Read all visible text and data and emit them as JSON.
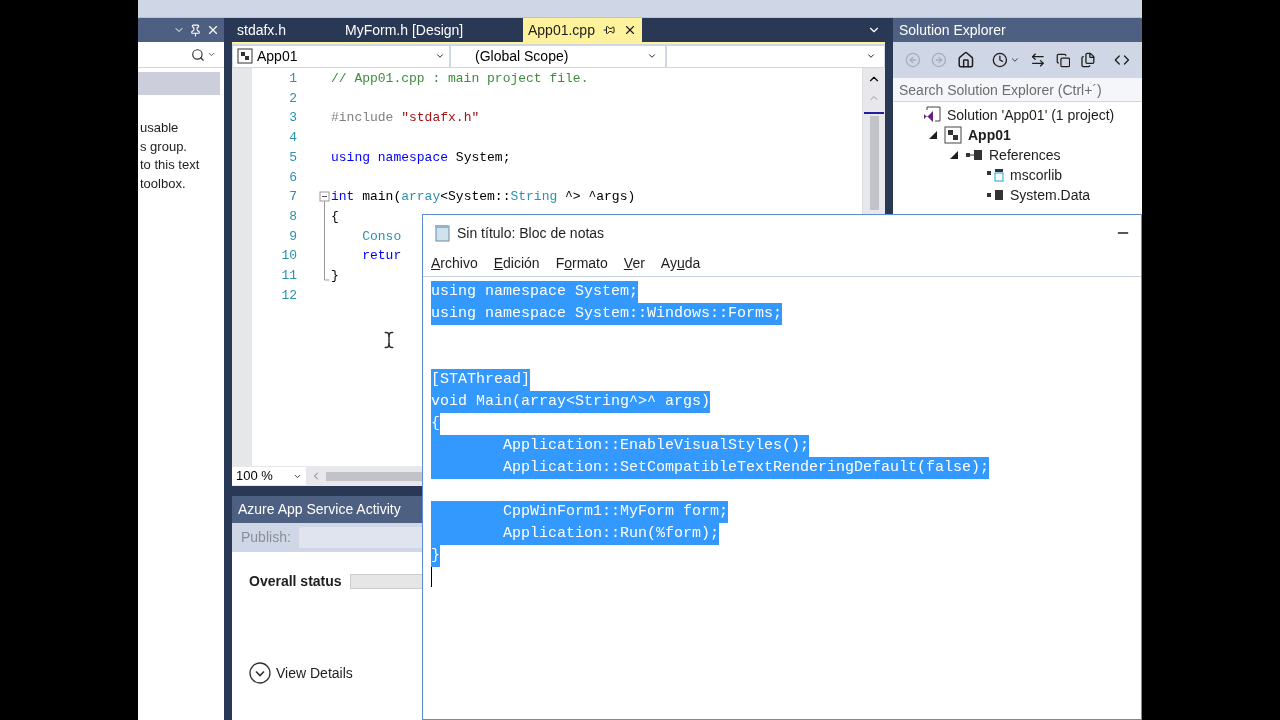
{
  "toolbox": {
    "text_lines": [
      "usable",
      "s group.",
      "to this text",
      "toolbox."
    ]
  },
  "editor": {
    "tabs": [
      {
        "label": "stdafx.h",
        "selected": false
      },
      {
        "label": "MyForm.h [Design]",
        "selected": false
      },
      {
        "label": "App01.cpp",
        "selected": true
      }
    ],
    "project_dropdown": "App01",
    "scope_dropdown": "(Global Scope)",
    "lines": [
      {
        "number": "1",
        "tokens": [
          {
            "kind": "comment",
            "text": "// App01.cpp : main project file."
          }
        ]
      },
      {
        "number": "2"
      },
      {
        "number": "3",
        "tokens": [
          {
            "kind": "preproc",
            "text": "#include "
          },
          {
            "kind": "string",
            "text": "\"stdafx.h\""
          }
        ]
      },
      {
        "number": "4"
      },
      {
        "number": "5",
        "tokens": [
          {
            "kind": "keyword",
            "text": "using namespace"
          },
          {
            "kind": "plain",
            "text": " System;"
          }
        ]
      },
      {
        "number": "6"
      },
      {
        "number": "7",
        "kind": "fold_start",
        "tokens": [
          {
            "kind": "keyword",
            "text": "int"
          },
          {
            "kind": "plain",
            "text": " main("
          },
          {
            "kind": "type",
            "text": "array"
          },
          {
            "kind": "plain",
            "text": "<System::"
          },
          {
            "kind": "type",
            "text": "String"
          },
          {
            "kind": "plain",
            "text": " ^> ^args)"
          }
        ]
      },
      {
        "number": "8",
        "kind": "fold_line",
        "tokens": [
          {
            "kind": "plain",
            "text": "{"
          }
        ]
      },
      {
        "number": "9",
        "kind": "fold_line",
        "tokens": [
          {
            "kind": "type",
            "text": "    Conso"
          }
        ]
      },
      {
        "number": "10",
        "kind": "fold_line",
        "tokens": [
          {
            "kind": "keyword",
            "text": "    retur"
          }
        ]
      },
      {
        "number": "11",
        "kind": "fold_end",
        "tokens": [
          {
            "kind": "plain",
            "text": "}"
          }
        ]
      },
      {
        "number": "12"
      }
    ],
    "zoom": "100 %"
  },
  "azure_panel": {
    "title": "Azure App Service Activity",
    "publish_label": "Publish:",
    "status": {
      "label": "Overall status",
      "level": 0
    },
    "details_link": "View Details"
  },
  "solution_explorer": {
    "title": "Solution Explorer",
    "search": {
      "placeholder": "Search Solution Explorer (Ctrl+´)"
    },
    "tree": [
      {
        "label": "Solution 'App01' (1 project)",
        "kind": "solution",
        "children": [
          {
            "label": "App01",
            "kind": "project",
            "expanded": true,
            "children": [
              {
                "label": "References",
                "kind": "references",
                "expanded": true,
                "children": [
                  {
                    "label": "mscorlib",
                    "kind": "assembly"
                  },
                  {
                    "label": "System.Data",
                    "kind": "reference"
                  }
                ]
              }
            ]
          }
        ]
      }
    ]
  },
  "notepad": {
    "title": "Sin título: Bloc de notas",
    "menu": [
      {
        "key": "A",
        "after": "rchivo"
      },
      {
        "key": "E",
        "after": "dición"
      },
      {
        "before": "F",
        "key": "o",
        "after": "rmato"
      },
      {
        "key": "V",
        "after": "er"
      },
      {
        "before": "Ay",
        "key": "u",
        "after": "da"
      }
    ],
    "lines": [
      {
        "kind": "text",
        "text": "using namespace System;",
        "selected": true
      },
      {
        "kind": "text",
        "text": "using namespace System::Windows::Forms;",
        "selected": true
      },
      {
        "kind": "blank"
      },
      {
        "kind": "blank"
      },
      {
        "kind": "text",
        "text": "[STAThread]",
        "selected": true
      },
      {
        "kind": "text",
        "text": "void Main(array<String^>^ args)",
        "selected": true
      },
      {
        "kind": "text",
        "text": "{",
        "selected": true
      },
      {
        "kind": "text",
        "text": "\tApplication::EnableVisualStyles();",
        "selected": true
      },
      {
        "kind": "text",
        "text": "\tApplication::SetCompatibleTextRenderingDefault(false);",
        "selected": true
      },
      {
        "kind": "blank"
      },
      {
        "kind": "text",
        "text": "\tCppWinForm1::MyForm form;",
        "selected": true
      },
      {
        "kind": "text",
        "text": "\tApplication::Run(%form);",
        "selected": true
      },
      {
        "kind": "text",
        "text": "}",
        "selected": true
      }
    ]
  }
}
